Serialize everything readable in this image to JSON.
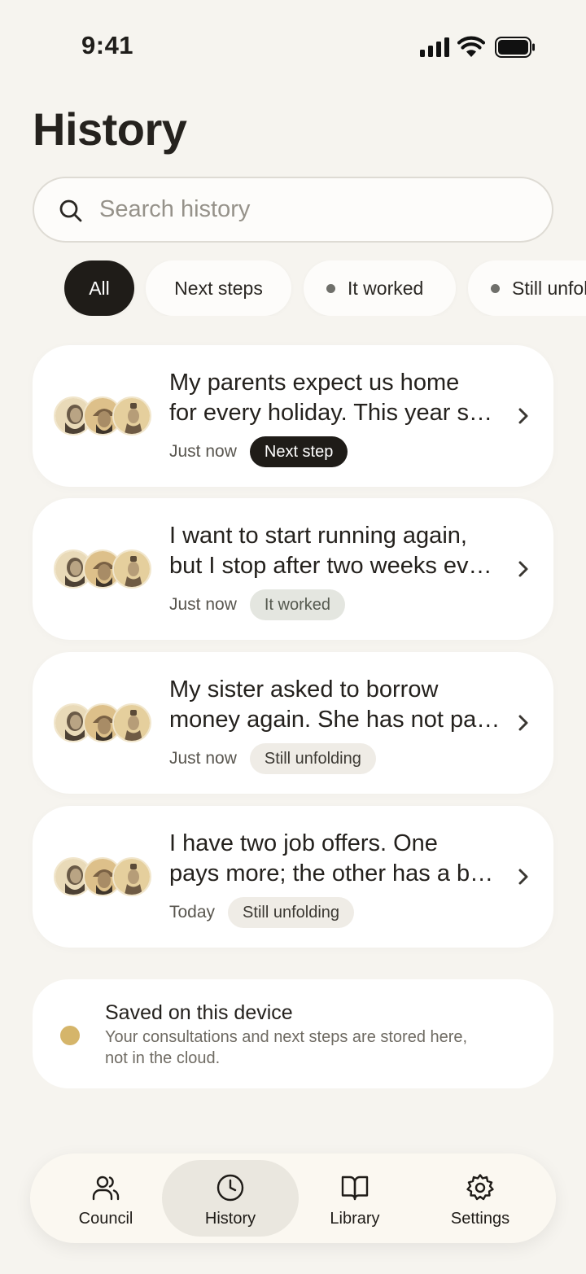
{
  "status_bar": {
    "time": "9:41"
  },
  "page_title": "History",
  "search": {
    "placeholder": "Search history",
    "value": ""
  },
  "filters": [
    {
      "label": "All",
      "active": true,
      "dot": false
    },
    {
      "label": "Next steps",
      "active": false,
      "dot": false
    },
    {
      "label": "It worked",
      "active": false,
      "dot": true
    },
    {
      "label": "Still unfolding",
      "active": false,
      "dot": true
    }
  ],
  "consultations": [
    {
      "line1": "My parents expect us home",
      "line2": "for every holiday. This year shifts the usual plan.",
      "time": "Just now",
      "status": "Next step",
      "status_kind": "next"
    },
    {
      "line1": "I want to start running again,",
      "line2": "but I stop after two weeks every time.",
      "time": "Just now",
      "status": "It worked",
      "status_kind": "worked"
    },
    {
      "line1": "My sister asked to borrow",
      "line2": "money again. She has not paid back the last loan.",
      "time": "Just now",
      "status": "Still unfolding",
      "status_kind": "unfold"
    },
    {
      "line1": "I have two job offers. One",
      "line2": "pays more; the other has a better team.",
      "time": "Today",
      "status": "Still unfolding",
      "status_kind": "unfold"
    }
  ],
  "saved_notice": {
    "title": "Saved on this device",
    "line1": "Your consultations and next steps are stored here,",
    "line2": "not in the cloud."
  },
  "tabs": [
    {
      "label": "Council",
      "icon": "users-icon",
      "active": false
    },
    {
      "label": "History",
      "icon": "clock-icon",
      "active": true
    },
    {
      "label": "Library",
      "icon": "book-icon",
      "active": false
    },
    {
      "label": "Settings",
      "icon": "gear-icon",
      "active": false
    }
  ],
  "colors": {
    "background": "#f6f4ef",
    "ink": "#1f1c18",
    "accent_gold": "#d5b56a"
  }
}
